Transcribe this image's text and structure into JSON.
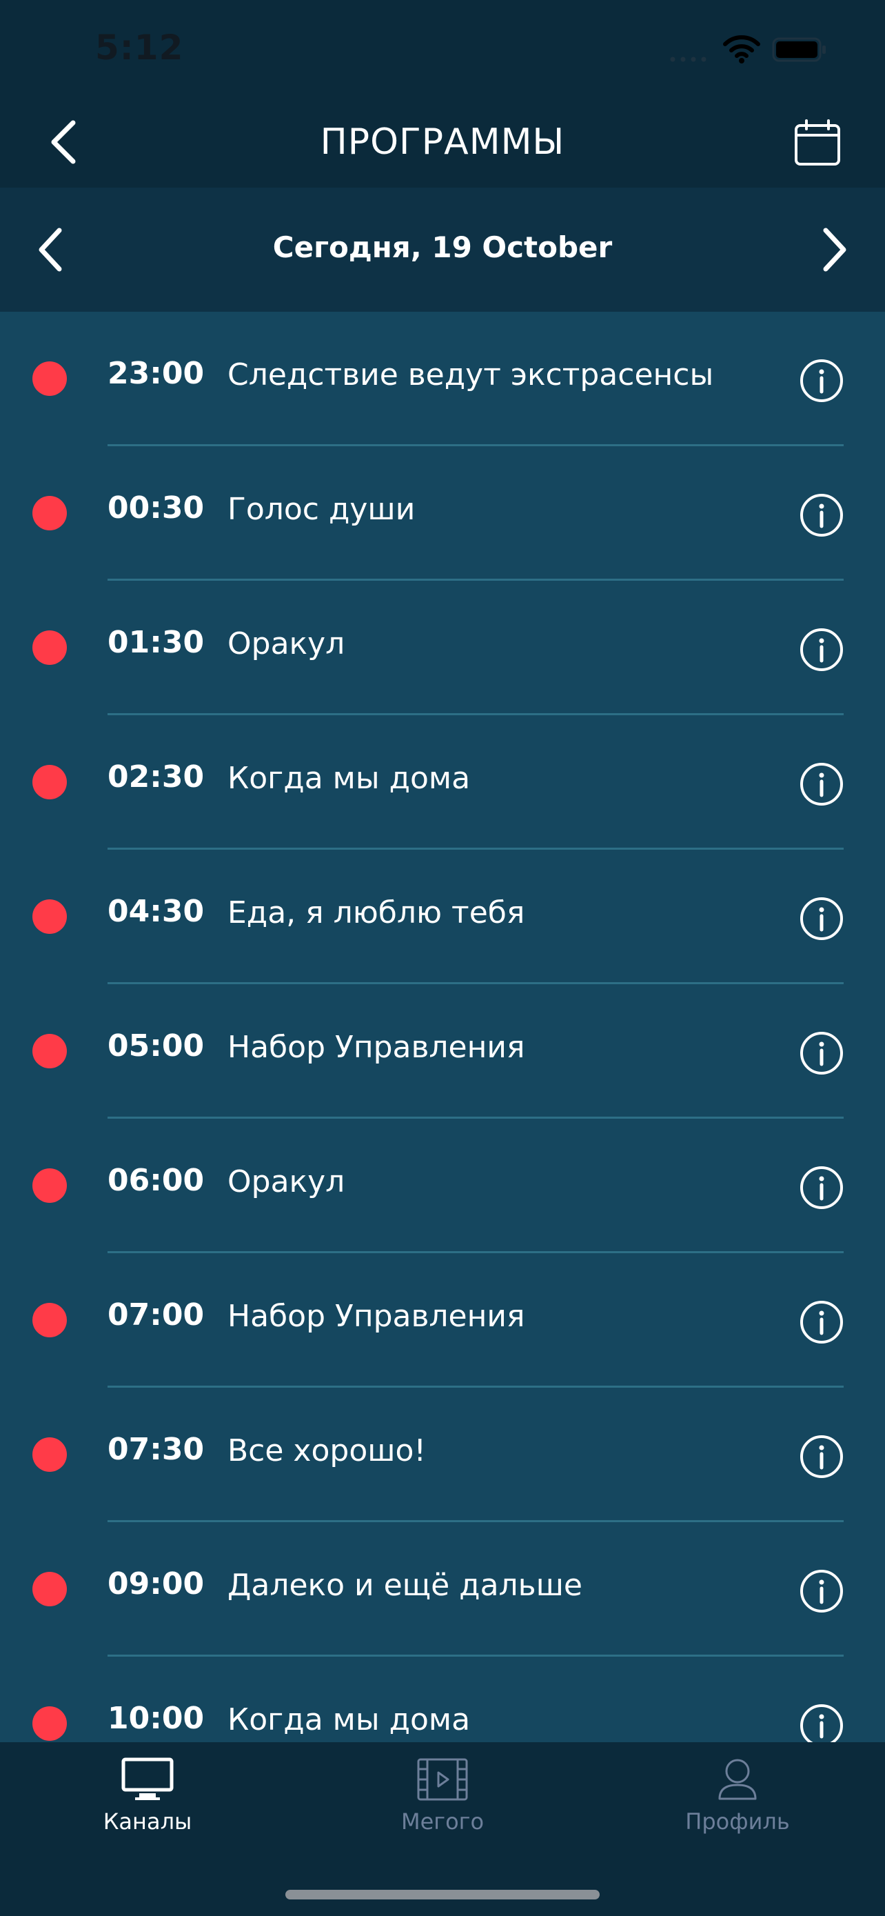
{
  "status_bar": {
    "time": "5:12"
  },
  "nav": {
    "title": "ПРОГРАММЫ"
  },
  "date_bar": {
    "label": "Сегодня, 19 October"
  },
  "programs": [
    {
      "time": "23:00",
      "title": "Следствие ведут экстрасенсы"
    },
    {
      "time": "00:30",
      "title": "Голос души"
    },
    {
      "time": "01:30",
      "title": "Оракул"
    },
    {
      "time": "02:30",
      "title": "Когда мы дома"
    },
    {
      "time": "04:30",
      "title": "Еда, я люблю тебя"
    },
    {
      "time": "05:00",
      "title": "Набор Управления"
    },
    {
      "time": "06:00",
      "title": "Оракул"
    },
    {
      "time": "07:00",
      "title": "Набор Управления"
    },
    {
      "time": "07:30",
      "title": "Все хорошо!"
    },
    {
      "time": "09:00",
      "title": "Далеко и ещё дальше"
    },
    {
      "time": "10:00",
      "title": "Когда мы дома"
    }
  ],
  "tabs": [
    {
      "label": "Каналы",
      "icon": "tv-icon",
      "active": true
    },
    {
      "label": "Мегого",
      "icon": "film-icon",
      "active": false
    },
    {
      "label": "Профиль",
      "icon": "user-icon",
      "active": false
    }
  ],
  "colors": {
    "background": "#0b2a3b",
    "list_background": "#15475f",
    "record_dot": "#ff3b48",
    "divider": "#2d6f86",
    "tab_inactive": "#6d7f9a"
  }
}
